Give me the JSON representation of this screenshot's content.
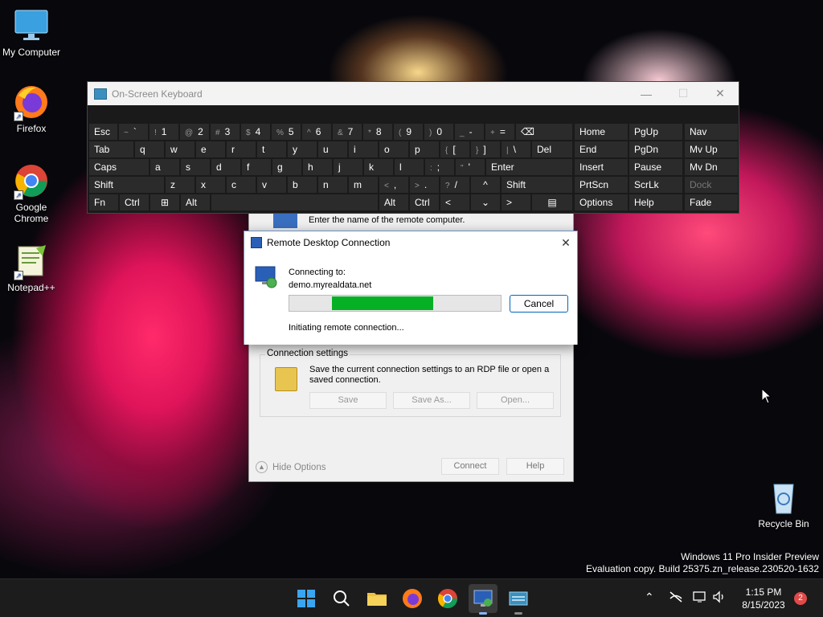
{
  "desktop": {
    "icons": [
      {
        "label": "My Computer",
        "icon": "monitor-icon"
      },
      {
        "label": "Firefox",
        "icon": "firefox-icon"
      },
      {
        "label": "Google\nChrome",
        "icon": "chrome-icon"
      },
      {
        "label": "Notepad++",
        "icon": "notepadpp-icon"
      },
      {
        "label": "Recycle Bin",
        "icon": "recycle-bin-icon"
      }
    ],
    "watermark": {
      "line1": "Windows 11 Pro Insider Preview",
      "line2": "Evaluation copy. Build 25375.zn_release.230520-1632"
    }
  },
  "osk": {
    "title": "On-Screen Keyboard",
    "minimize": "—",
    "maximize": "☐",
    "close": "✕",
    "row1": [
      "Esc",
      "~",
      "`",
      "!",
      "1",
      "@",
      "2",
      "#",
      "3",
      "$",
      "4",
      "%",
      "5",
      "^",
      "6",
      "&",
      "7",
      "*",
      "8",
      "(",
      "9",
      ")",
      "0",
      "_",
      "-",
      "+",
      "=",
      "⌫"
    ],
    "row2": [
      "Tab",
      "q",
      "w",
      "e",
      "r",
      "t",
      "y",
      "u",
      "i",
      "o",
      "p",
      "{",
      "[",
      "}",
      "]",
      "|",
      "\\",
      "Del"
    ],
    "row3": [
      "Caps",
      "a",
      "s",
      "d",
      "f",
      "g",
      "h",
      "j",
      "k",
      "l",
      ":",
      ";",
      "\"",
      "'",
      "Enter"
    ],
    "row4": [
      "Shift",
      "z",
      "x",
      "c",
      "v",
      "b",
      "n",
      "m",
      "<",
      ",",
      ">",
      ".",
      "?",
      "/",
      "^",
      "Shift"
    ],
    "row5": [
      "Fn",
      "Ctrl",
      "⊞",
      "Alt",
      "Alt",
      "Ctrl",
      "<",
      "⌄",
      ">",
      "▤"
    ],
    "nav": {
      "col1": [
        "Home",
        "End",
        "Insert",
        "PrtScn",
        "Options"
      ],
      "col2": [
        "PgUp",
        "PgDn",
        "Pause",
        "ScrLk",
        "Help"
      ],
      "col3": [
        "Nav",
        "Mv Up",
        "Mv Dn",
        "Dock",
        "Fade"
      ]
    }
  },
  "rdp_background": {
    "hint": "Enter the name of the remote computer.",
    "group_label": "Connection settings",
    "group_text": "Save the current connection settings to an RDP file or open a saved connection.",
    "save": "Save",
    "save_as": "Save As...",
    "open": "Open...",
    "hide_options": "Hide Options",
    "hide_glyph": "▲",
    "connect": "Connect",
    "help": "Help"
  },
  "dialog": {
    "title": "Remote Desktop Connection",
    "close": "✕",
    "connecting_to_label": "Connecting to:",
    "host": "demo.myrealdata.net",
    "progress_start": 0.2,
    "progress_end": 0.68,
    "cancel": "Cancel",
    "status": "Initiating remote connection..."
  },
  "taskbar": {
    "apps": [
      "start-icon",
      "search-icon",
      "file-explorer-icon",
      "firefox-icon",
      "chrome-icon",
      "remote-desktop-icon",
      "osk-icon"
    ],
    "tray": {
      "chevron": "⌃",
      "time": "1:15 PM",
      "date": "8/15/2023",
      "notifications": "2"
    }
  },
  "colors": {
    "progress": "#06b025",
    "accent": "#0067c0"
  }
}
